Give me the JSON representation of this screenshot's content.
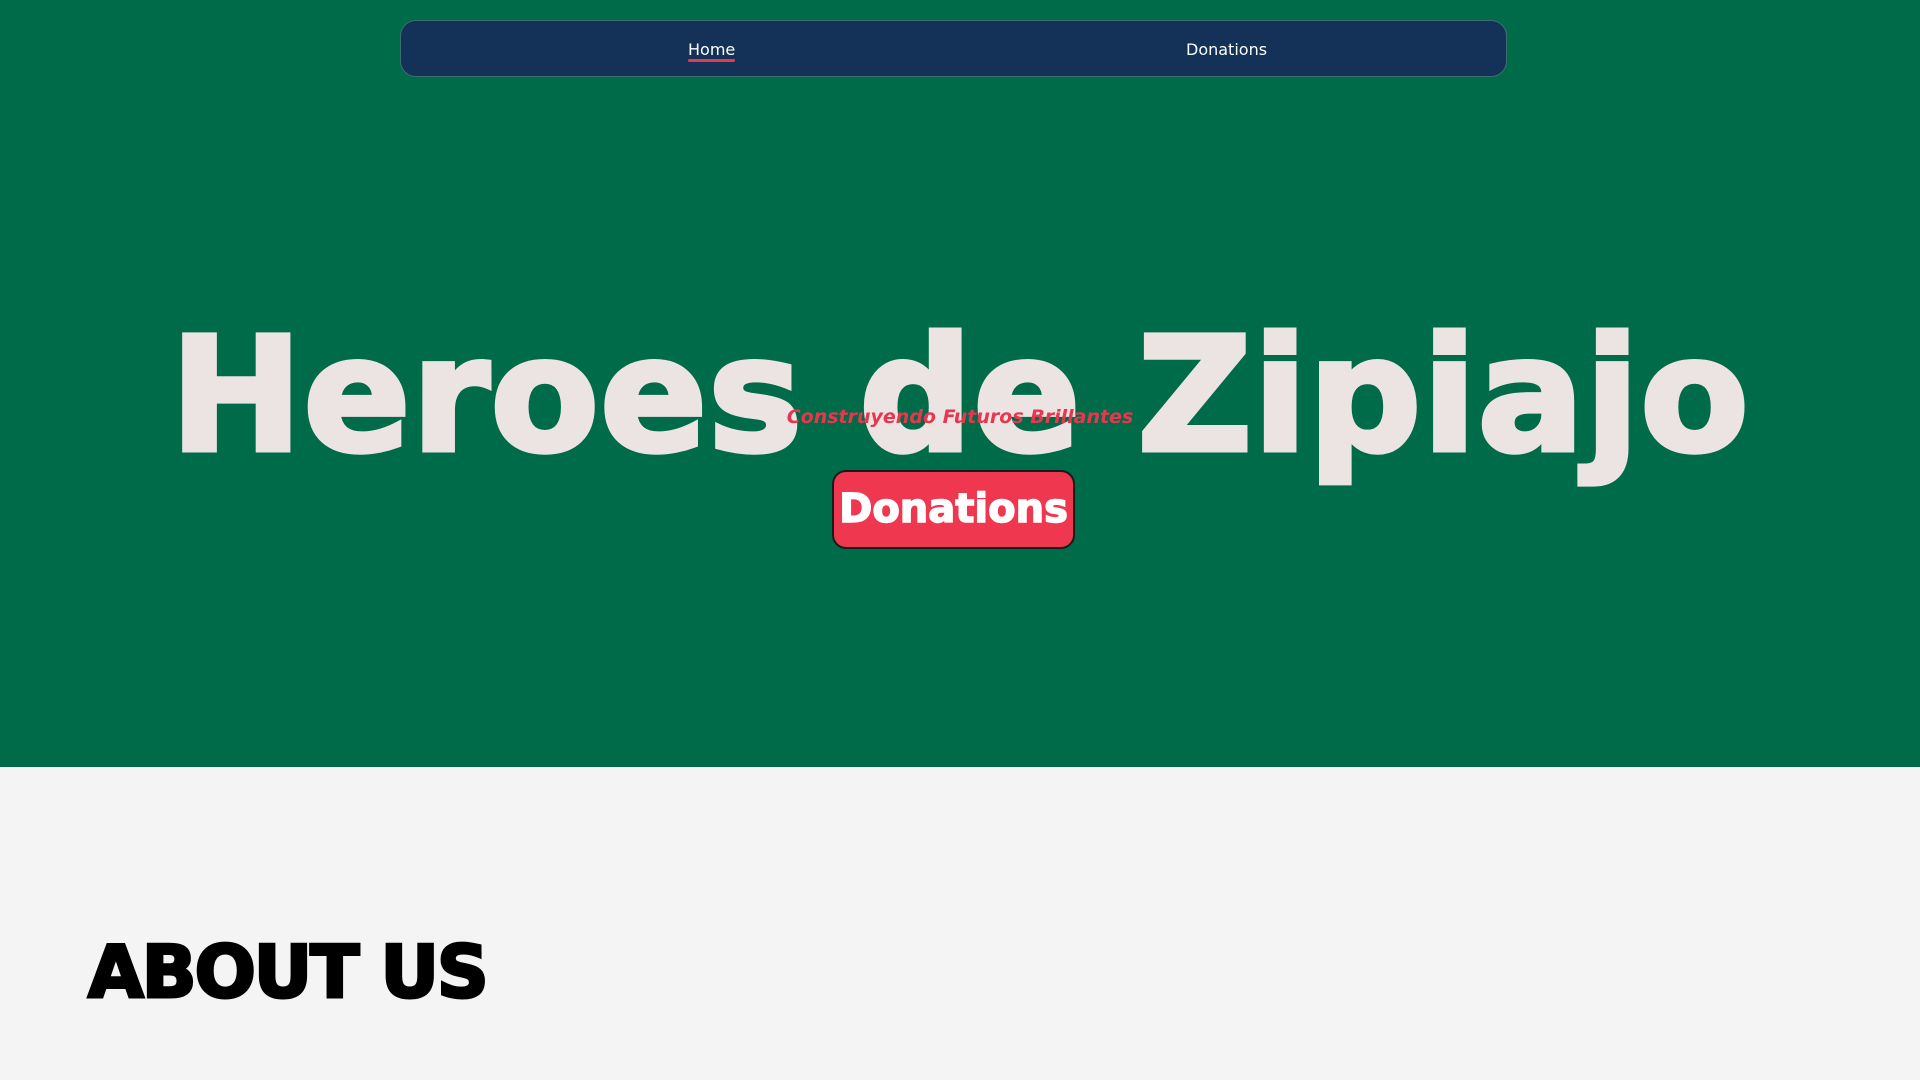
{
  "nav": {
    "items": [
      {
        "label": "Home",
        "active": true
      },
      {
        "label": "Donations",
        "active": false
      }
    ]
  },
  "hero": {
    "title": "Heroes de Zipiajo",
    "subtitle": "Construyendo Futuros Brillantes",
    "cta_label": "Donations"
  },
  "about": {
    "heading": "ABOUT US"
  },
  "colors": {
    "hero_background": "#006b49",
    "nav_background": "#143157",
    "accent": "#ef3750",
    "title_text": "#ece3e3",
    "about_background": "#f4f4f4"
  }
}
